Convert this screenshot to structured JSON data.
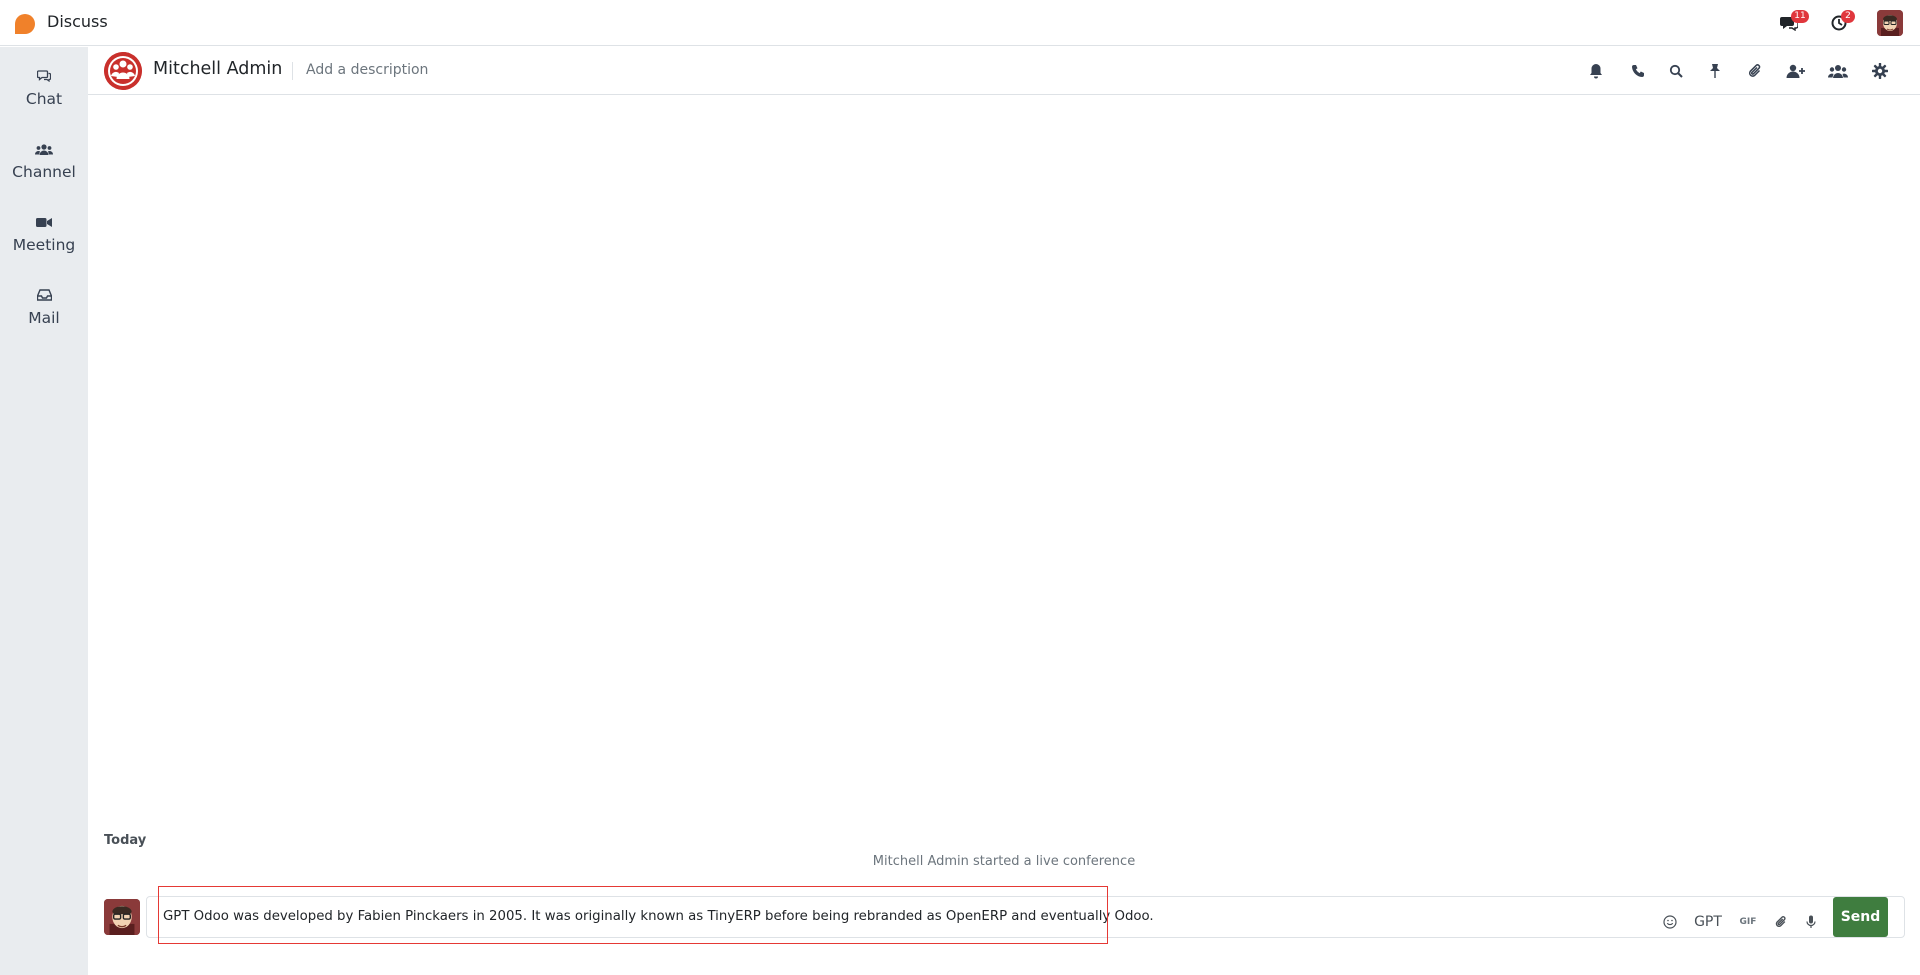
{
  "navbar": {
    "app_title": "Discuss",
    "messages_badge": "11",
    "activities_badge": "2",
    "brand_color": "#f0812a",
    "badge_color": "#e0373d"
  },
  "sidebar": {
    "items": [
      {
        "label": "Chat",
        "icon": "chat-icon"
      },
      {
        "label": "Channel",
        "icon": "users-icon"
      },
      {
        "label": "Meeting",
        "icon": "video-icon"
      },
      {
        "label": "Mail",
        "icon": "inbox-icon"
      }
    ]
  },
  "thread": {
    "name": "Mitchell Admin",
    "description_placeholder": "Add a description",
    "header_icons": [
      "bell-icon",
      "phone-icon",
      "search-icon",
      "pin-icon",
      "paperclip-icon",
      "add-user-icon",
      "members-icon",
      "gear-icon"
    ]
  },
  "messages": {
    "day_label": "Today",
    "notification": "Mitchell Admin started a live conference"
  },
  "composer": {
    "text": "GPT Odoo was developed by Fabien Pinckaers in 2005. It was originally known as TinyERP before being rebranded as OpenERP and eventually Odoo.",
    "gpt_label": "GPT",
    "gif_label": "GIF",
    "send_label": "Send",
    "send_color": "#3f7d3f",
    "highlight_color": "#e53935"
  }
}
